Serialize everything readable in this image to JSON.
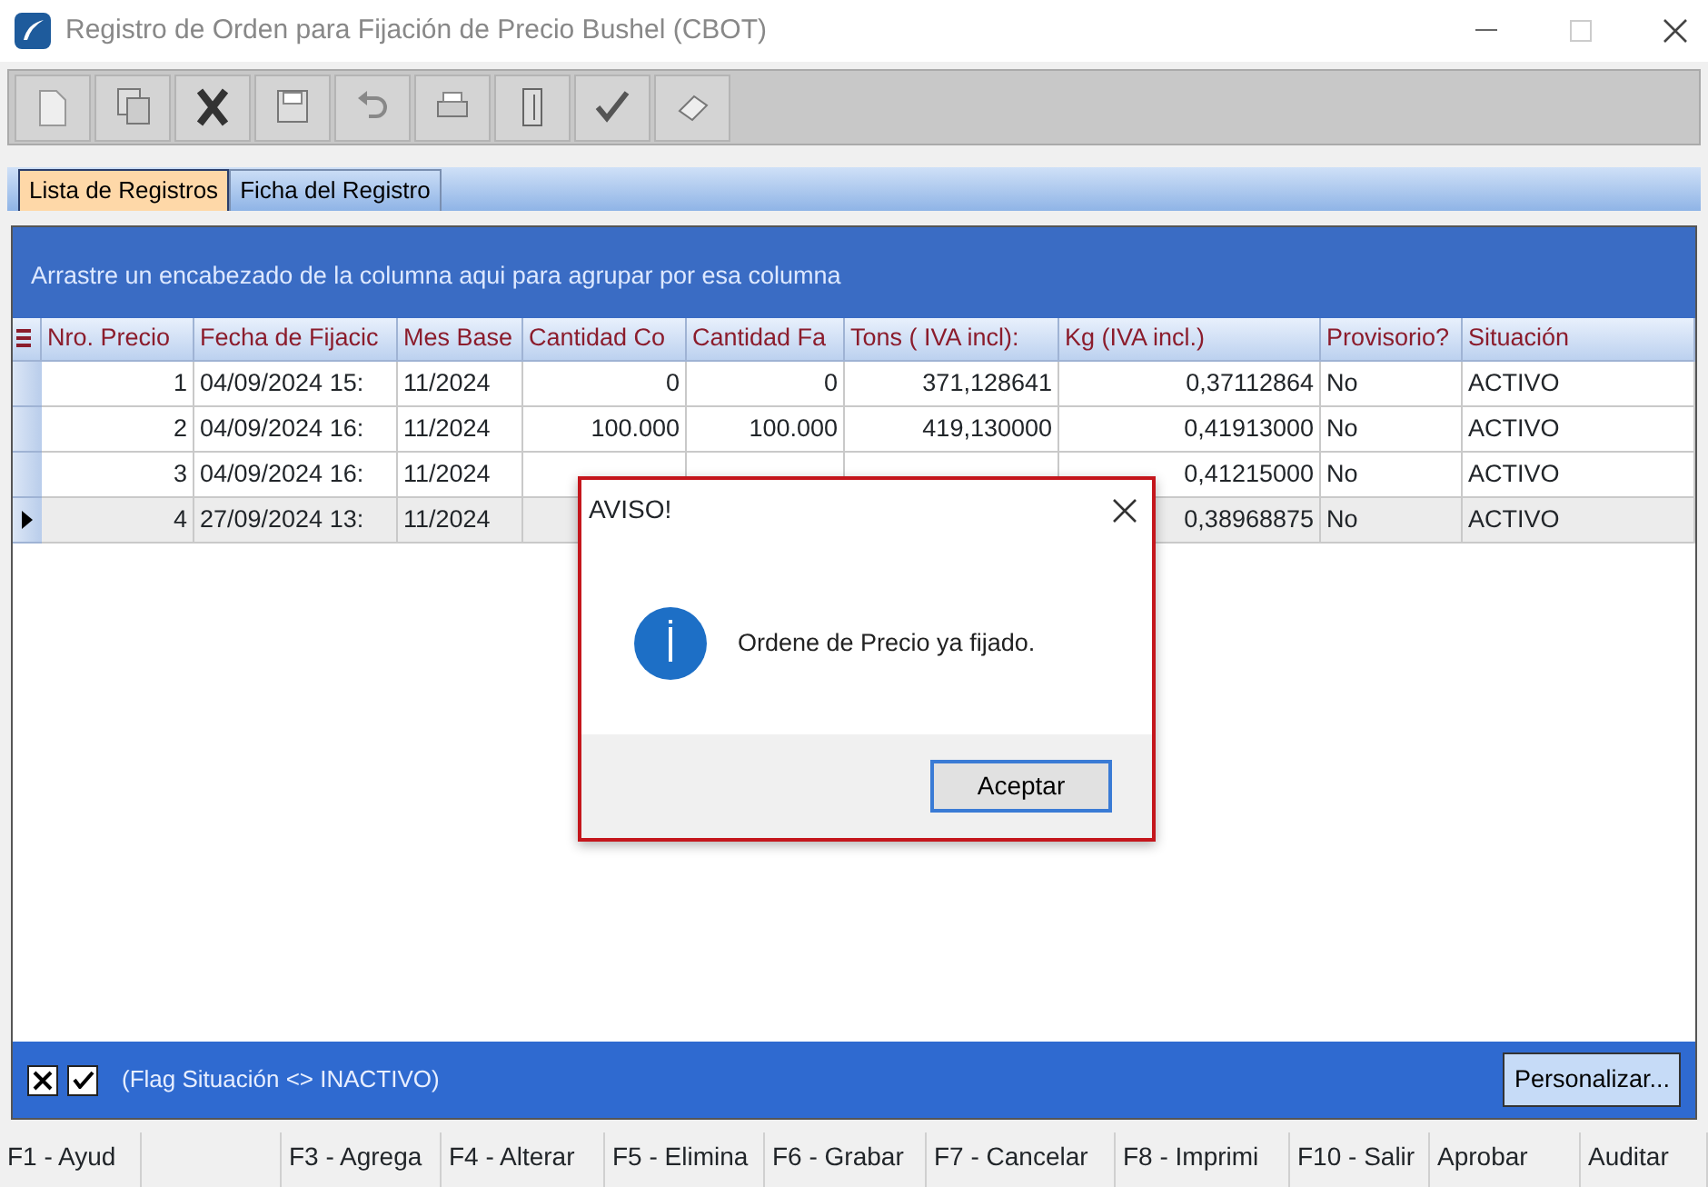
{
  "window": {
    "title": "Registro de Orden para Fijación de Precio Bushel (CBOT)"
  },
  "toolbar": [
    {
      "kind": "new"
    },
    {
      "kind": "copy"
    },
    {
      "kind": "delete"
    },
    {
      "kind": "save"
    },
    {
      "kind": "undo"
    },
    {
      "kind": "print"
    },
    {
      "kind": "door"
    },
    {
      "kind": "check"
    },
    {
      "kind": "eraser"
    }
  ],
  "tabs": [
    {
      "label": "Lista de Registros",
      "selected": true
    },
    {
      "label": "Ficha del Registro",
      "selected": false
    }
  ],
  "group_panel": {
    "text": "Arrastre un encabezado de la columna aqui para agrupar por esa columna"
  },
  "table": {
    "columns": [
      "Nro. Precio",
      "Fecha de Fijacic",
      "Mes Base",
      "Cantidad Co",
      "Cantidad Fa",
      "Tons ( IVA incl):",
      "Kg (IVA incl.)",
      "Provisorio?",
      "Situación"
    ],
    "rows": [
      {
        "selected": false,
        "cells": [
          "1",
          "04/09/2024 15:",
          "11/2024",
          "0",
          "0",
          "371,128641",
          "0,37112864",
          "No",
          "ACTIVO"
        ]
      },
      {
        "selected": false,
        "cells": [
          "2",
          "04/09/2024 16:",
          "11/2024",
          "100.000",
          "100.000",
          "419,130000",
          "0,41913000",
          "No",
          "ACTIVO"
        ]
      },
      {
        "selected": false,
        "cells": [
          "3",
          "04/09/2024 16:",
          "11/2024",
          null,
          null,
          null,
          "0,41215000",
          "No",
          "ACTIVO"
        ]
      },
      {
        "selected": true,
        "cells": [
          "4",
          "27/09/2024 13:",
          "11/2024",
          null,
          null,
          null,
          "0,38968875",
          "No",
          "ACTIVO"
        ]
      }
    ]
  },
  "filter_bar": {
    "checked": true,
    "text": "(Flag Situación <> INACTIVO)",
    "button": "Personalizar..."
  },
  "function_keys": [
    {
      "kind": "key",
      "label": "F1 - Ayud"
    },
    {
      "kind": "empty"
    },
    {
      "kind": "key",
      "label": "F3 - Agrega"
    },
    {
      "kind": "key",
      "label": "F4 - Alterar"
    },
    {
      "kind": "key",
      "label": "F5 - Elimina"
    },
    {
      "kind": "key",
      "label": "F6 - Grabar"
    },
    {
      "kind": "key",
      "label": "F7 - Cancelar"
    },
    {
      "kind": "key",
      "label": "F8 - Imprimi"
    },
    {
      "kind": "key",
      "label": "F10 - Salir"
    },
    {
      "kind": "key",
      "label": "Aprobar"
    },
    {
      "kind": "key",
      "label": "Auditar"
    }
  ],
  "dialog": {
    "title": "AVISO!",
    "message": "Ordene de Precio ya fijado.",
    "button": "Aceptar"
  }
}
